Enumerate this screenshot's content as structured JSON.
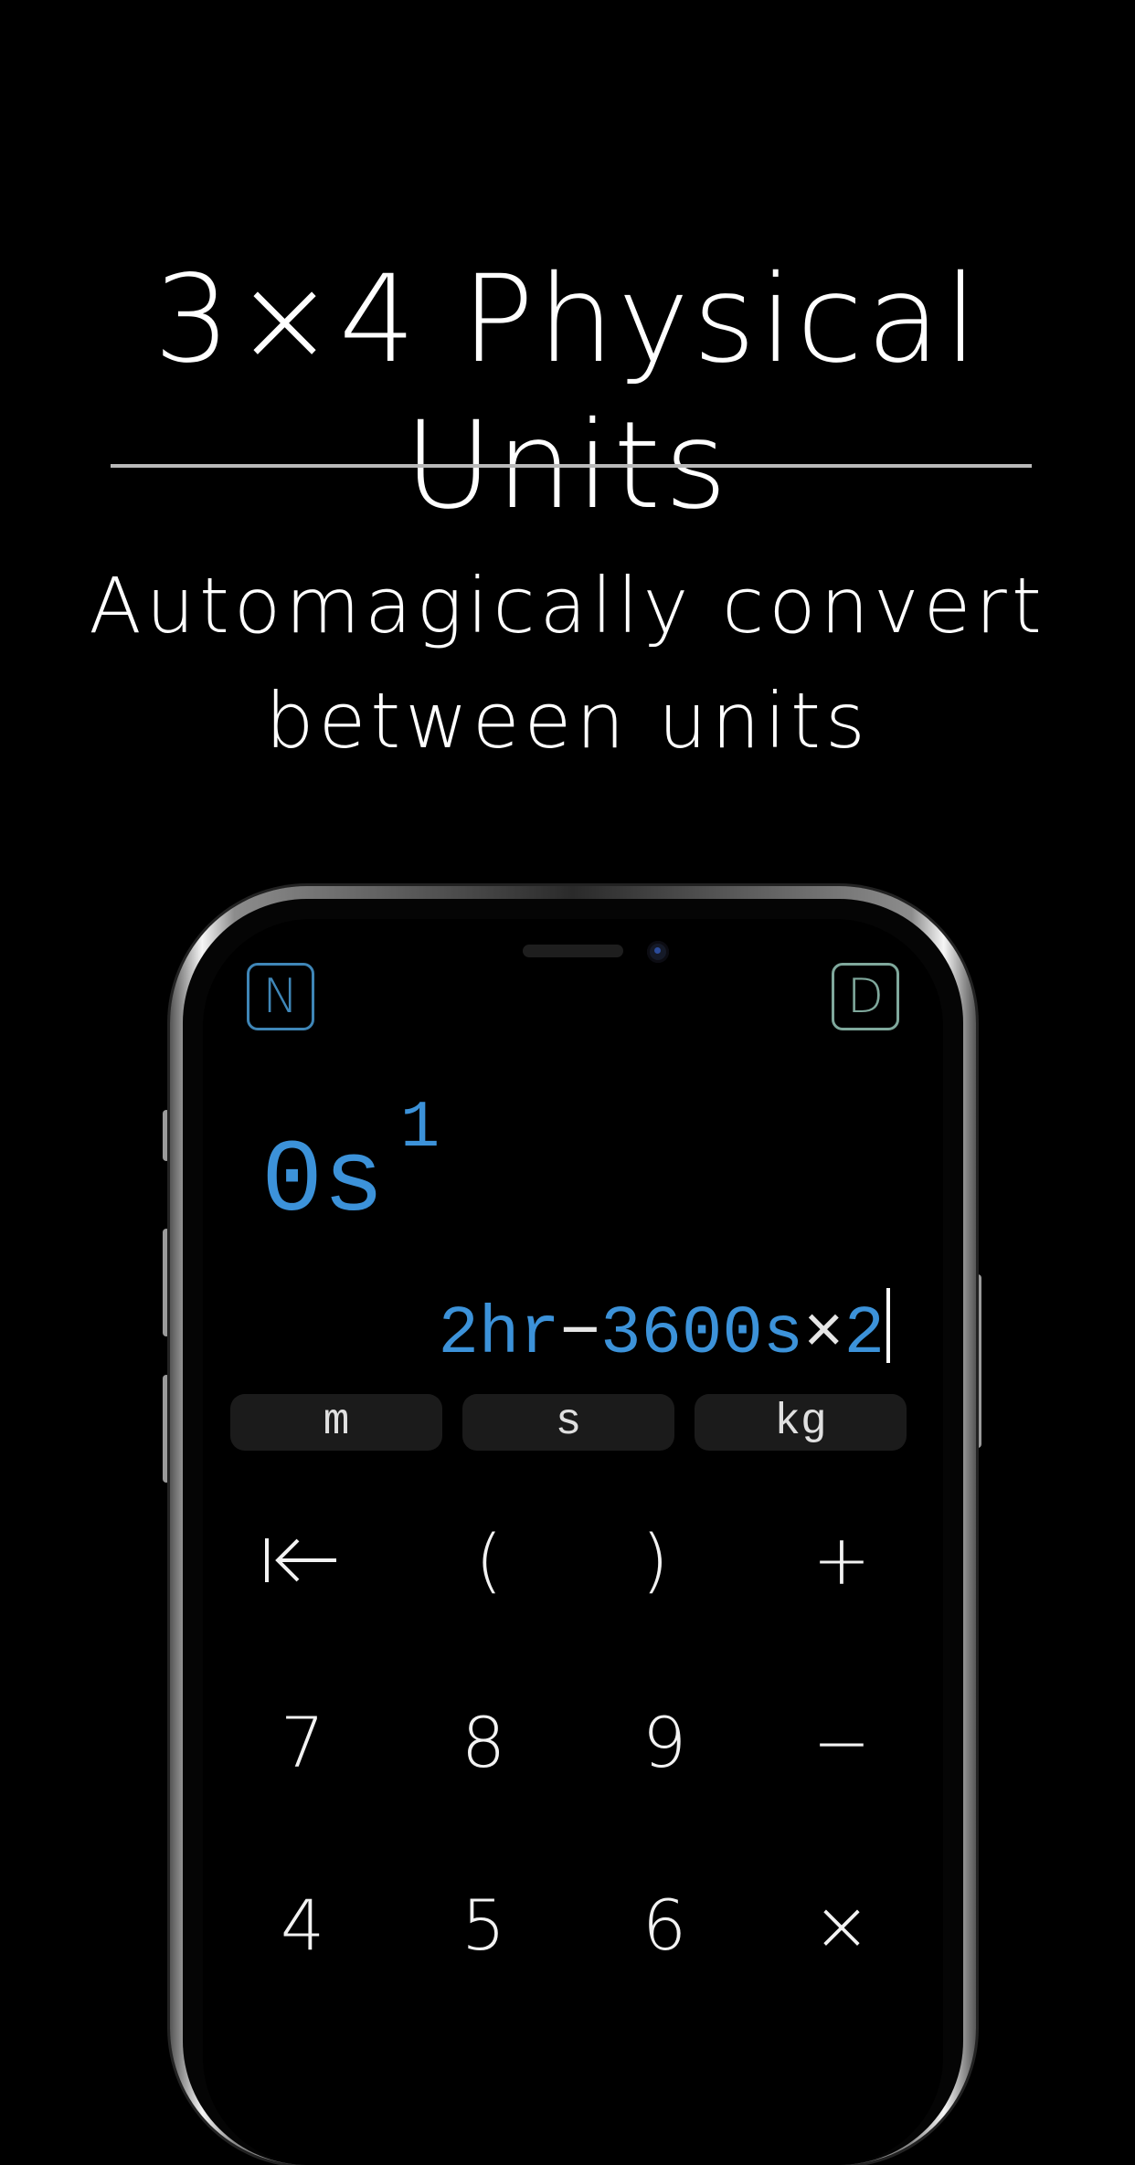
{
  "headline": "3×4 Physical Units",
  "subheadline": {
    "line1": "Automagically convert",
    "line2": "between units"
  },
  "app": {
    "mode_left": "N",
    "mode_right": "D",
    "result": {
      "value": "0s",
      "exponent": "1"
    },
    "expression": {
      "part1": "2hr",
      "operator1": "−",
      "part2": "3600s",
      "operator2": "×",
      "part3": "2"
    },
    "unit_buttons": [
      "m",
      "s",
      "kg"
    ],
    "keypad": {
      "row1": [
        "backspace-icon",
        "(",
        ")",
        "+"
      ],
      "row2": [
        "7",
        "8",
        "9",
        "−"
      ],
      "row3": [
        "4",
        "5",
        "6",
        "×"
      ]
    },
    "colors": {
      "accent_blue": "#3c92d9",
      "mode_n": "#3f86b7",
      "mode_d": "#7fa89c"
    }
  }
}
